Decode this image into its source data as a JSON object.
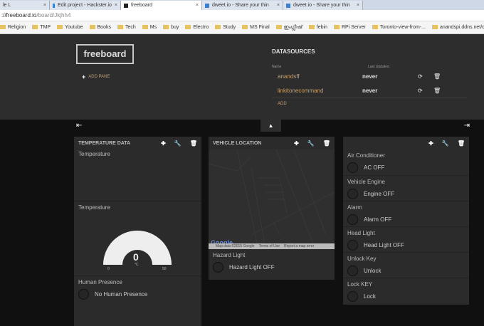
{
  "browser": {
    "tabs": [
      {
        "label": "le L"
      },
      {
        "label": "Edit project - Hackster.io"
      },
      {
        "label": "freeboard",
        "active": true
      },
      {
        "label": "dweet.io - Share your thin"
      },
      {
        "label": "dweet.io - Share your thin"
      }
    ],
    "url_host": "://freeboard.io",
    "url_path": "/board/Jkjhh4",
    "bookmarks": [
      "Religion",
      "TMP",
      "Youtube",
      "Books",
      "Tech",
      "Ms",
      "buy",
      "Electro",
      "Study",
      "MS Final",
      "ഇംഗ്ലീഷ്",
      "febin",
      "RPi Server",
      "Toronto-view-from-...",
      "anandspi.ddns.net/c..."
    ]
  },
  "header": {
    "logo": "freeboard",
    "add_pane": "ADD PANE",
    "datasources": {
      "title": "DATASOURCES",
      "col_name": "Name",
      "col_updated": "Last Updated",
      "rows": [
        {
          "name": "anandsff",
          "updated": "never"
        },
        {
          "name": "linkitonecommand",
          "updated": "never"
        }
      ],
      "add": "ADD"
    }
  },
  "panes": [
    {
      "title": "TEMPERATURE DATA",
      "widgets": {
        "text_title": "Temperature",
        "gauge_title": "Temperature",
        "gauge_value": "0",
        "gauge_unit": "°C",
        "gauge_min": "0",
        "gauge_max": "50",
        "ind_title": "Human Presence",
        "ind_text": "No Human Presence"
      }
    },
    {
      "title": "VEHICLE LOCATION",
      "map_attr": [
        "Map data ©2015 Google",
        "Terms of Use",
        "Report a map error"
      ],
      "map_logo": "Google",
      "ind_title": "Hazard Light",
      "ind_text": "Hazard Light OFF"
    },
    {
      "title": "",
      "indicators": [
        {
          "title": "Air Conditioner",
          "text": "AC OFF"
        },
        {
          "title": "Vehicle Engine",
          "text": "Engine OFF"
        },
        {
          "title": "Alarm",
          "text": "Alarm OFF"
        },
        {
          "title": "Head Light",
          "text": "Head Light OFF"
        },
        {
          "title": "Unlock Key",
          "text": "Unlock"
        },
        {
          "title": "Lock KEY",
          "text": "Lock"
        }
      ]
    }
  ]
}
